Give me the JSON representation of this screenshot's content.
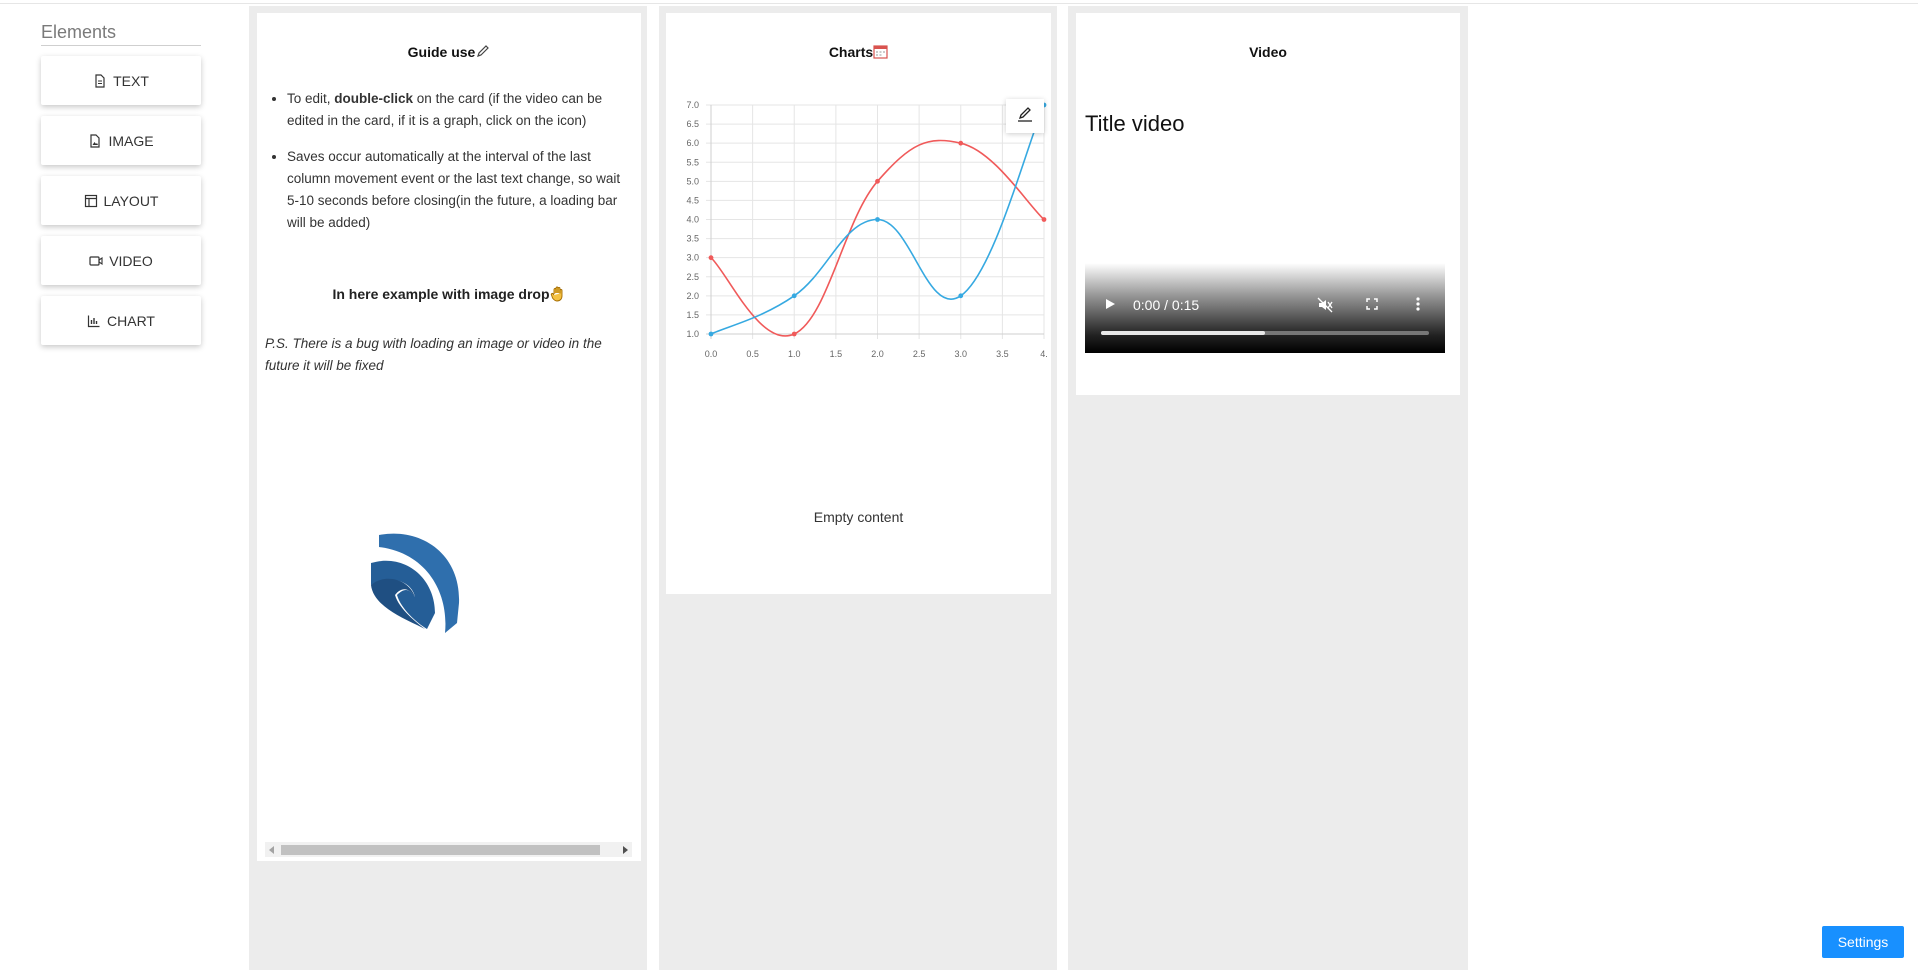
{
  "sidebar": {
    "title": "Elements",
    "items": [
      {
        "label": "TEXT",
        "icon": "file-text-icon"
      },
      {
        "label": "IMAGE",
        "icon": "file-image-icon"
      },
      {
        "label": "LAYOUT",
        "icon": "layout-icon"
      },
      {
        "label": "VIDEO",
        "icon": "video-icon"
      },
      {
        "label": "CHART",
        "icon": "bar-chart-icon"
      }
    ]
  },
  "guide": {
    "title": "Guide use",
    "bullet1_a": "To edit, ",
    "bullet1_b": "double-click",
    "bullet1_c": " on the card (if the video can be edited in the card, if it is a graph, click on the icon)",
    "bullet2": "Saves occur automatically at the interval of the last column movement event or the last text change, so wait 5-10 seconds before closing(in the future, a loading bar will be added)",
    "drop_title": "In here example with image drop",
    "ps": "P.S. There is a bug with loading an image or video in the future it will be fixed"
  },
  "charts": {
    "title": "Charts",
    "empty": "Empty content"
  },
  "chart_data": {
    "type": "line",
    "x": [
      0,
      1,
      2,
      3,
      4
    ],
    "series": [
      {
        "values": [
          3,
          1,
          5,
          6,
          4
        ],
        "color": "#f05a5a"
      },
      {
        "values": [
          1,
          2,
          4,
          2,
          7
        ],
        "color": "#36a9e1"
      }
    ],
    "xticks": [
      "0.0",
      "0.5",
      "1.0",
      "1.5",
      "2.0",
      "2.5",
      "3.0",
      "3.5",
      "4."
    ],
    "yticks": [
      "1.0",
      "1.5",
      "2.0",
      "2.5",
      "3.0",
      "3.5",
      "4.0",
      "4.5",
      "5.0",
      "5.5",
      "6.0",
      "6.5",
      "7.0"
    ],
    "xlim": [
      0,
      4
    ],
    "ylim": [
      1,
      7
    ],
    "grid": true
  },
  "video": {
    "title": "Video",
    "video_title": "Title video",
    "time": "0:00 / 0:15",
    "progress": 0.5
  },
  "settings_label": "Settings"
}
